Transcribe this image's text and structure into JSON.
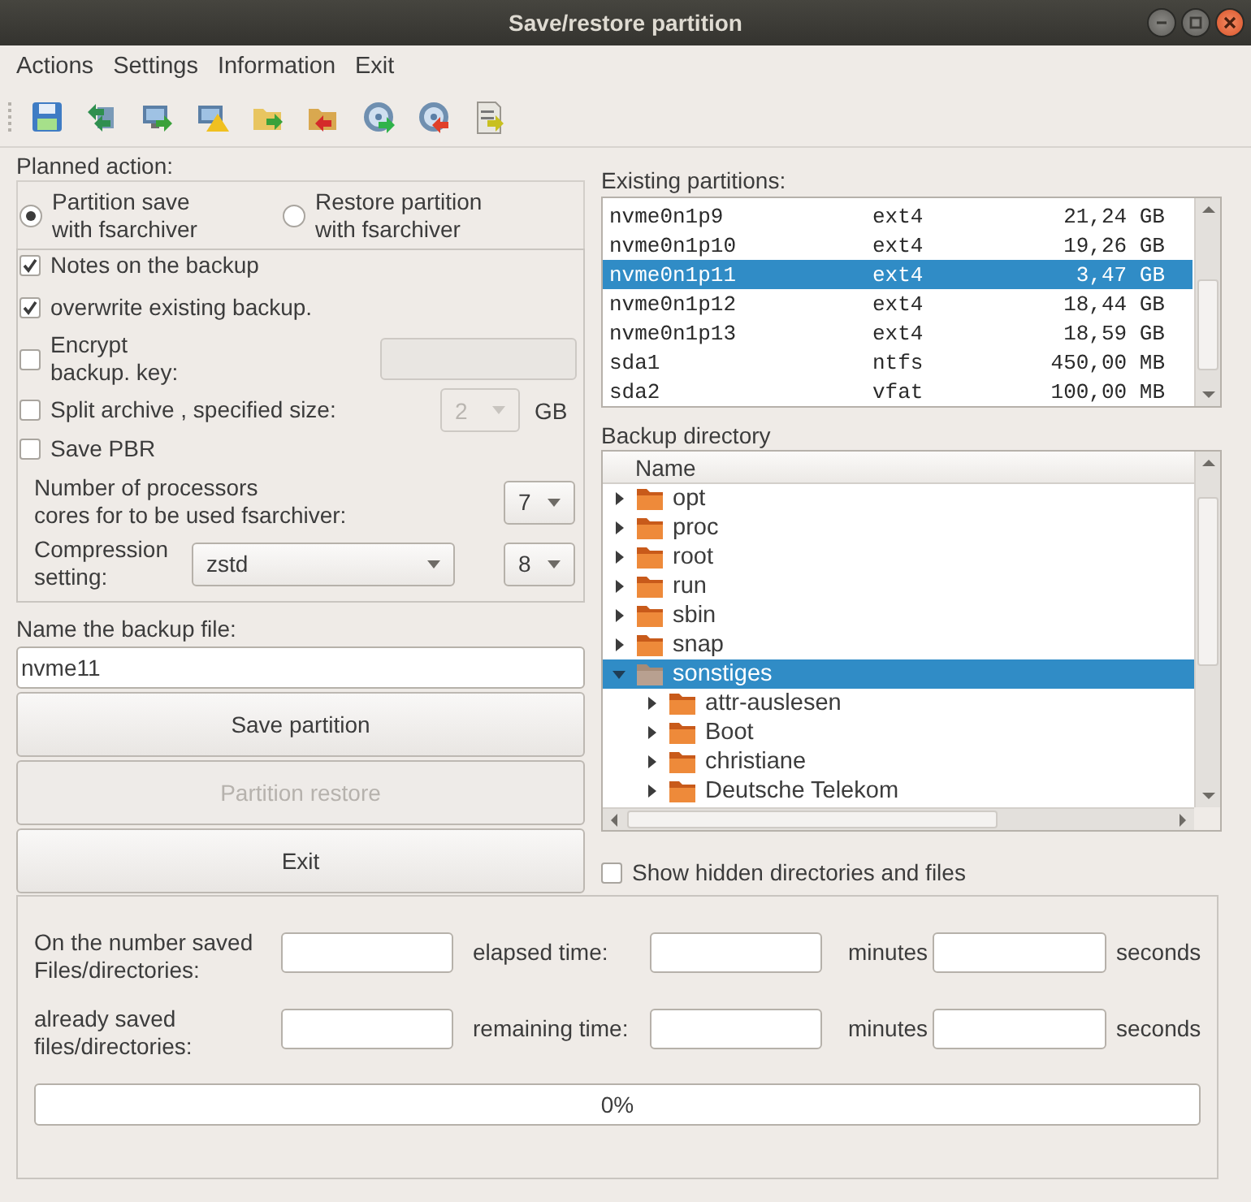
{
  "window": {
    "title": "Save/restore partition"
  },
  "menu": [
    "Actions",
    "Settings",
    "Information",
    "Exit"
  ],
  "planned_action": {
    "label": "Planned action:",
    "options": [
      {
        "label": "Partition save\nwith fsarchiver",
        "selected": true
      },
      {
        "label": "Restore partition\nwith fsarchiver",
        "selected": false
      }
    ]
  },
  "options": [
    {
      "kind": "checkbox",
      "label": "Notes on the backup",
      "checked": true
    },
    {
      "kind": "checkbox",
      "label": "overwrite existing backup.",
      "checked": true
    },
    {
      "kind": "checkbox_field",
      "label": "Encrypt\nbackup. key:",
      "checked": false,
      "disabled": true
    },
    {
      "kind": "checkbox_combo",
      "label": "Split archive , specified size:",
      "checked": false,
      "value": "2",
      "unit": "GB",
      "disabled": true
    },
    {
      "kind": "checkbox",
      "label": "Save PBR",
      "checked": false
    },
    {
      "kind": "combo",
      "label": "Number of processors\ncores for to be used fsarchiver:",
      "value": "7"
    },
    {
      "kind": "combo_pair",
      "label": "Compression\nsetting:",
      "value": "zstd",
      "second_value": "8"
    }
  ],
  "backup_name": {
    "label": "Name the backup file:",
    "value": "nvme11"
  },
  "buttons": [
    {
      "label": "Save partition",
      "disabled": false
    },
    {
      "label": "Partition restore",
      "disabled": true
    },
    {
      "label": "Exit",
      "disabled": false
    }
  ],
  "partitions": {
    "label": "Existing partitions:",
    "rows": [
      {
        "name": "nvme0n1p9",
        "fs": "ext4",
        "size": "21,24 GB",
        "selected": false
      },
      {
        "name": "nvme0n1p10",
        "fs": "ext4",
        "size": "19,26 GB",
        "selected": false
      },
      {
        "name": "nvme0n1p11",
        "fs": "ext4",
        "size": "3,47 GB",
        "selected": true
      },
      {
        "name": "nvme0n1p12",
        "fs": "ext4",
        "size": "18,44 GB",
        "selected": false
      },
      {
        "name": "nvme0n1p13",
        "fs": "ext4",
        "size": "18,59 GB",
        "selected": false
      },
      {
        "name": "sda1",
        "fs": "ntfs",
        "size": "450,00 MB",
        "selected": false
      },
      {
        "name": "sda2",
        "fs": "vfat",
        "size": "100,00 MB",
        "selected": false
      }
    ]
  },
  "backup_directory": {
    "label": "Backup directory",
    "column": "Name",
    "tree": [
      {
        "name": "opt",
        "expanded": false,
        "selected": false
      },
      {
        "name": "proc",
        "expanded": false,
        "selected": false
      },
      {
        "name": "root",
        "expanded": false,
        "selected": false
      },
      {
        "name": "run",
        "expanded": false,
        "selected": false
      },
      {
        "name": "sbin",
        "expanded": false,
        "selected": false
      },
      {
        "name": "snap",
        "expanded": false,
        "selected": false
      },
      {
        "name": "sonstiges",
        "expanded": true,
        "selected": true,
        "children": [
          {
            "name": "attr-auslesen",
            "expanded": false,
            "selected": false
          },
          {
            "name": "Boot",
            "expanded": false,
            "selected": false
          },
          {
            "name": "christiane",
            "expanded": false,
            "selected": false
          },
          {
            "name": "Deutsche Telekom",
            "expanded": false,
            "selected": false
          }
        ]
      }
    ]
  },
  "show_hidden": {
    "label": "Show hidden directories and files",
    "checked": false
  },
  "progress_panel": {
    "rows": [
      {
        "label": "On the number saved\nFiles/directories:",
        "time_label": "elapsed time:",
        "minutes_label": "minutes",
        "seconds_label": "seconds"
      },
      {
        "label": "already saved\nfiles/directories:",
        "time_label": "remaining time:",
        "minutes_label": "minutes",
        "seconds_label": "seconds"
      }
    ],
    "progress": {
      "level": 0,
      "text": "0%"
    }
  }
}
